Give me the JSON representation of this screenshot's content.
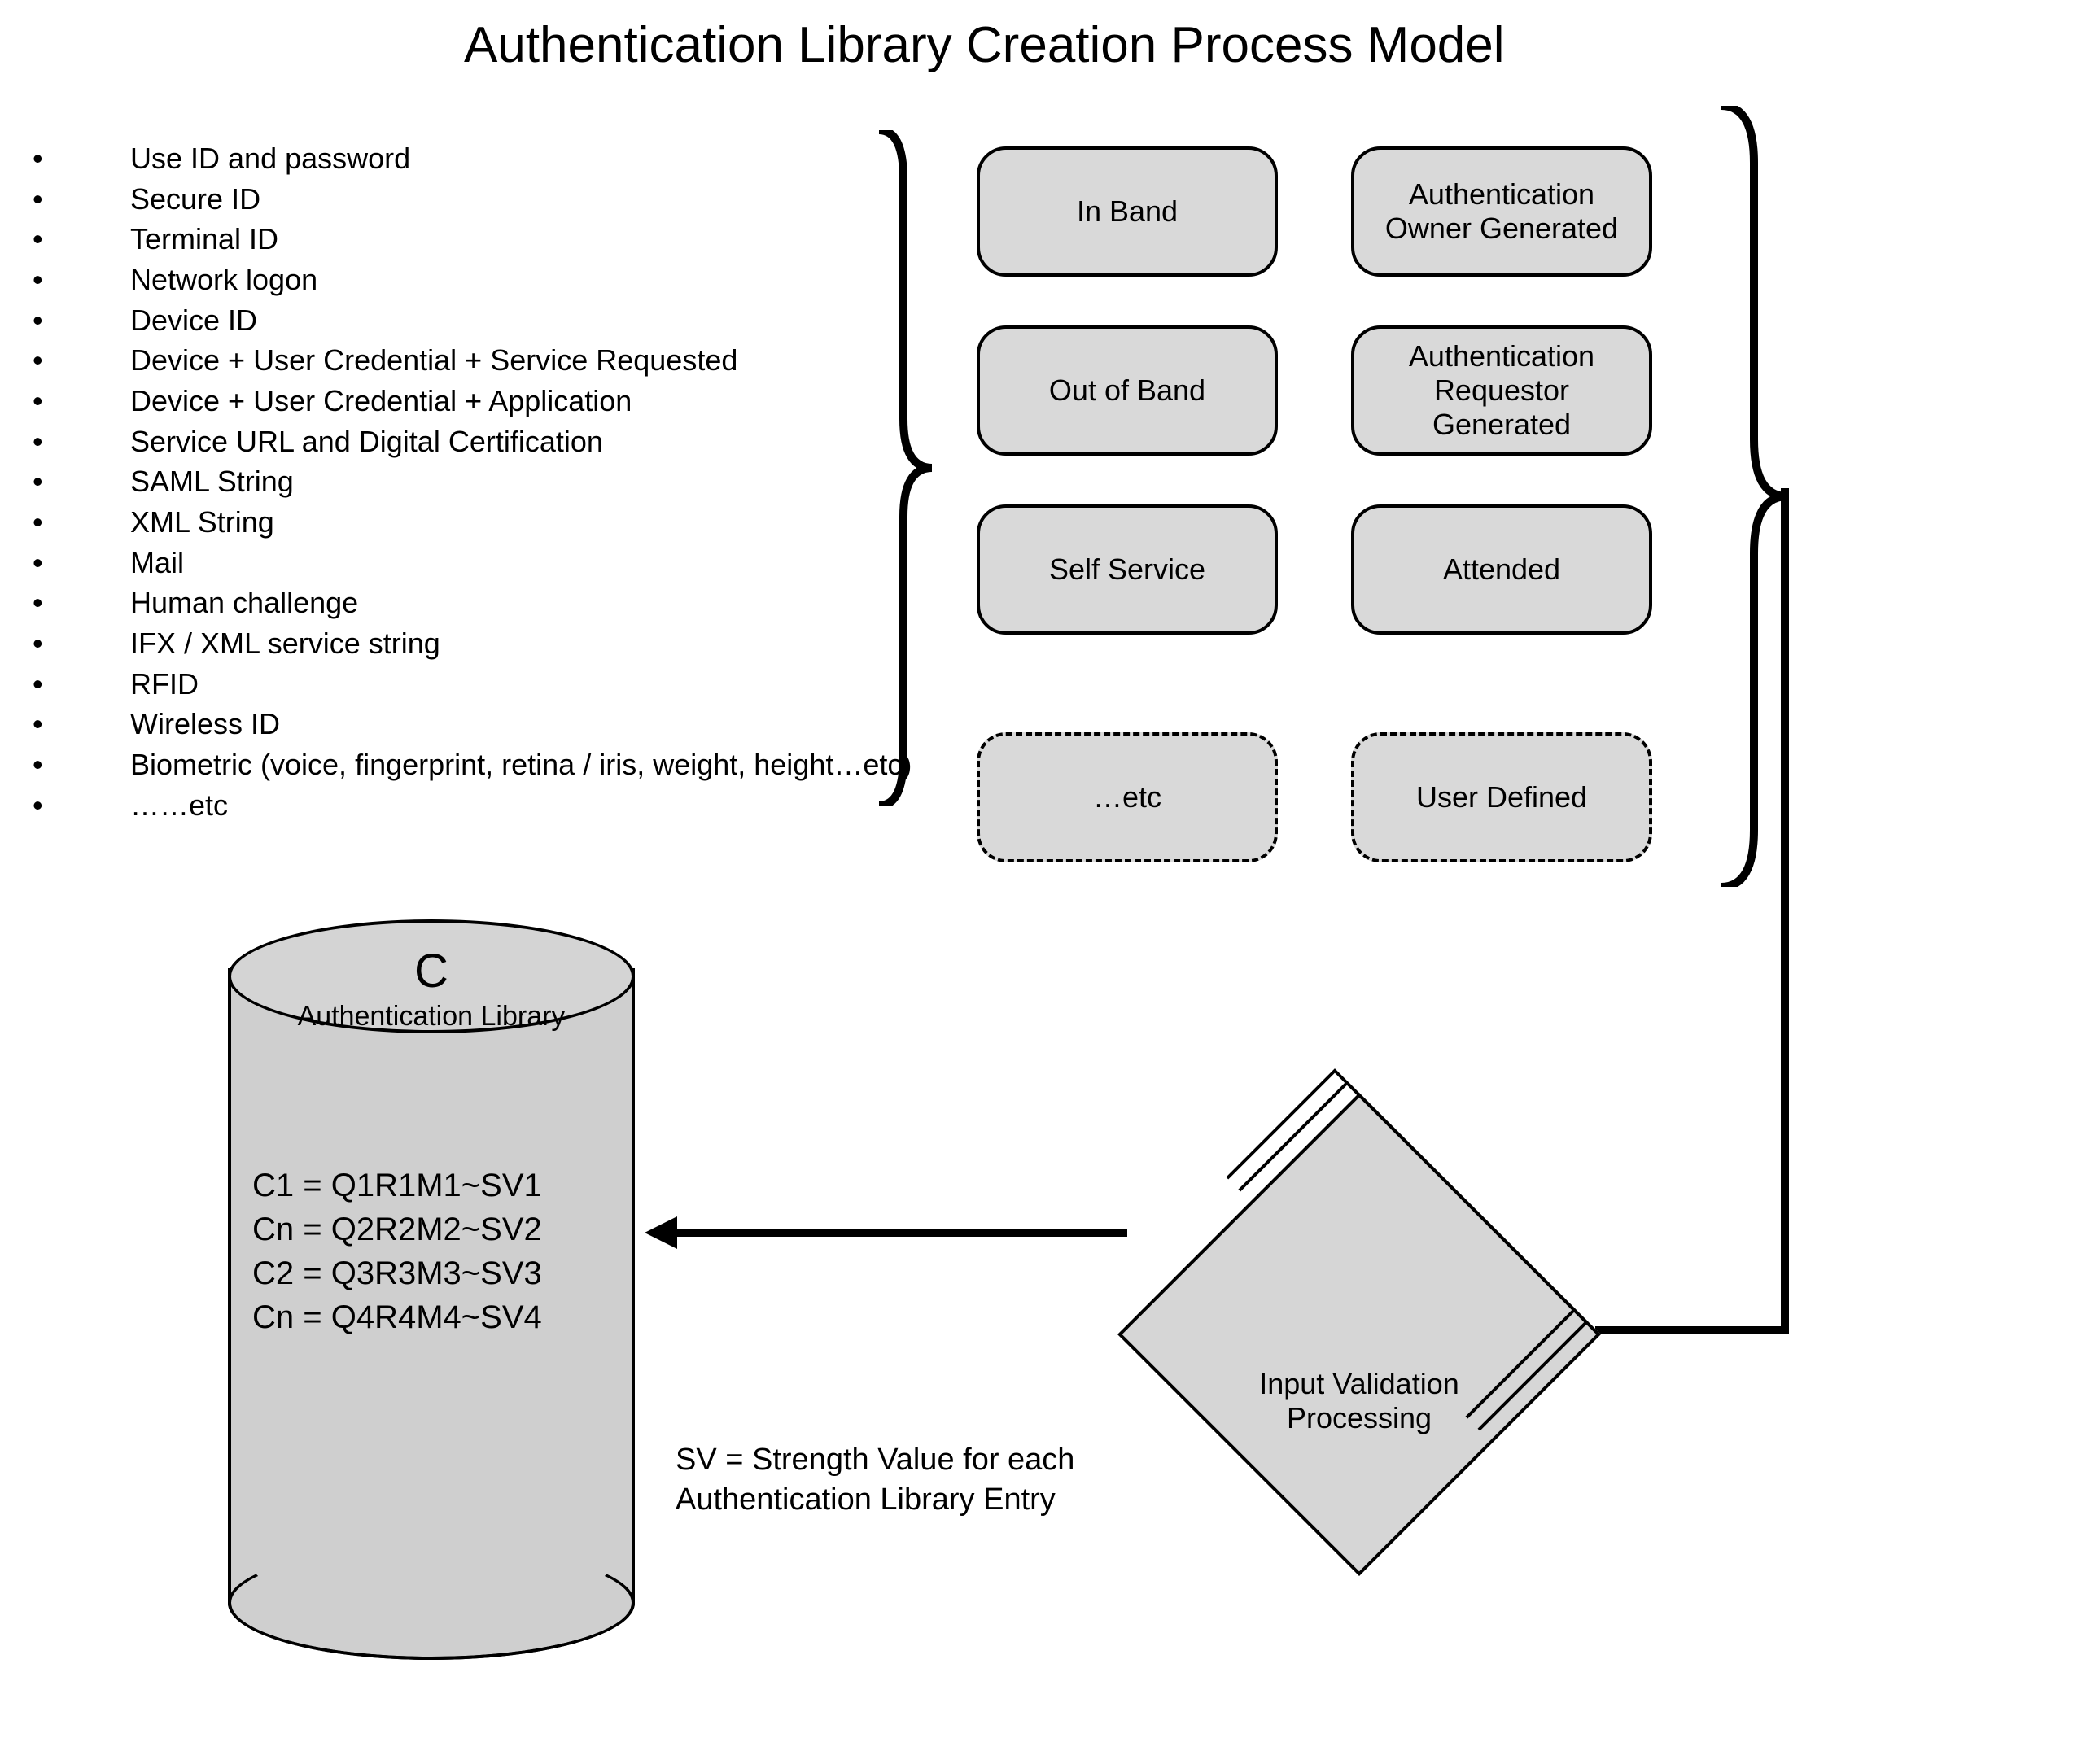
{
  "title": "Authentication Library Creation Process Model",
  "bullets": [
    "Use ID and password",
    "Secure ID",
    "Terminal ID",
    "Network logon",
    "Device ID",
    "Device + User Credential + Service Requested",
    "Device + User Credential + Application",
    "Service URL and Digital Certification",
    "SAML String",
    "XML String",
    "Mail",
    "Human challenge",
    "IFX / XML service string",
    "RFID",
    "Wireless ID",
    "Biometric (voice, fingerprint, retina / iris, weight, height…etc)",
    "……etc"
  ],
  "categories": {
    "col1": [
      {
        "label": "In Band",
        "dashed": false
      },
      {
        "label": "Out of Band",
        "dashed": false
      },
      {
        "label": "Self Service",
        "dashed": false
      },
      {
        "label": "…etc",
        "dashed": true
      }
    ],
    "col2": [
      {
        "label": "Authentication Owner Generated",
        "dashed": false
      },
      {
        "label": "Authentication Requestor Generated",
        "dashed": false
      },
      {
        "label": "Attended",
        "dashed": false
      },
      {
        "label": "User Defined",
        "dashed": true
      }
    ]
  },
  "cylinder": {
    "letter": "C",
    "label": "Authentication Library",
    "entries": [
      "C1 = Q1R1M1~SV1",
      "Cn = Q2R2M2~SV2",
      "C2 = Q3R3M3~SV3",
      "Cn = Q4R4M4~SV4"
    ]
  },
  "diamond": {
    "label_line1": "Input Validation",
    "label_line2": "Processing"
  },
  "sv_note_line1": "SV = Strength Value for each",
  "sv_note_line2": "Authentication Library Entry"
}
